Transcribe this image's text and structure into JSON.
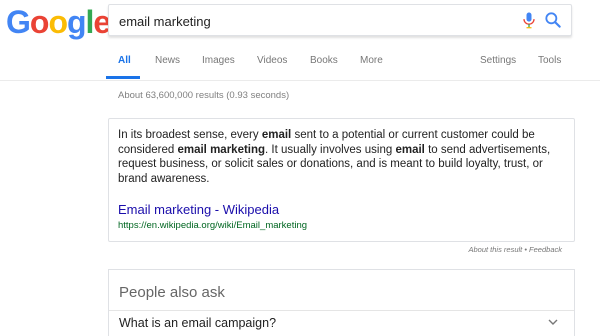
{
  "logo": {
    "letters": [
      "G",
      "o",
      "o",
      "g",
      "l",
      "e"
    ]
  },
  "search": {
    "query": "email marketing"
  },
  "tabs": [
    {
      "label": "All",
      "active": true
    },
    {
      "label": "News"
    },
    {
      "label": "Images"
    },
    {
      "label": "Videos"
    },
    {
      "label": "Books"
    },
    {
      "label": "More"
    },
    {
      "label": "Settings"
    },
    {
      "label": "Tools"
    }
  ],
  "results_count": "About 63,600,000 results (0.93 seconds)",
  "featured_snippet": {
    "t1": "In its broadest sense, every ",
    "b1": "email",
    "t2": " sent to a potential or current customer could be considered ",
    "b2": "email marketing",
    "t3": ". It usually involves using ",
    "b3": "email",
    "t4": " to send advertisements, request business, or solicit sales or donations, and is meant to build loyalty, trust, or brand awareness.",
    "source_title": "Email marketing - Wikipedia",
    "source_url": "https://en.wikipedia.org/wiki/Email_marketing"
  },
  "about_feedback": "About this result • Feedback",
  "people_also_ask": {
    "title": "People also ask",
    "questions": [
      "What is an email campaign?"
    ]
  },
  "colors": {
    "link": "#1a0dab",
    "url_green": "#006621",
    "accent_blue": "#1a73e8"
  },
  "icons": {
    "mic": "microphone-icon",
    "search": "search-icon",
    "chevron": "chevron-down-icon"
  }
}
